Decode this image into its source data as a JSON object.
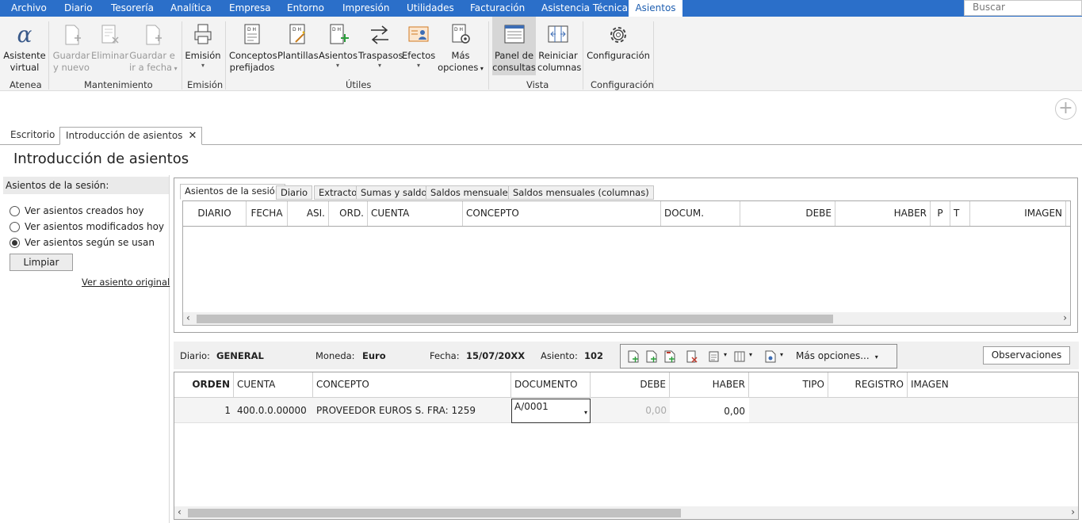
{
  "menu": {
    "items": [
      "Archivo",
      "Diario",
      "Tesorería",
      "Analítica",
      "Empresa",
      "Entorno",
      "Impresión",
      "Utilidades",
      "Facturación",
      "Asistencia Técnica",
      "Asientos"
    ],
    "search_placeholder": "Buscar"
  },
  "ribbon": {
    "buttons": {
      "asistente": [
        "Asistente",
        "virtual"
      ],
      "guardar_nuevo": [
        "Guardar",
        "y nuevo"
      ],
      "eliminar": [
        "Eliminar"
      ],
      "guardar_fecha": [
        "Guardar e",
        "ir a fecha"
      ],
      "emision": [
        "Emisión"
      ],
      "conceptos": [
        "Conceptos",
        "prefijados"
      ],
      "plantillas": [
        "Plantillas"
      ],
      "asientos": [
        "Asientos"
      ],
      "traspasos": [
        "Traspasos"
      ],
      "efectos": [
        "Efectos"
      ],
      "mas_opciones": [
        "Más",
        "opciones"
      ],
      "panel": [
        "Panel de",
        "consultas"
      ],
      "reiniciar": [
        "Reiniciar",
        "columnas"
      ],
      "configuracion": [
        "Configuración"
      ]
    },
    "groups": [
      "Atenea",
      "Mantenimiento",
      "Emisión",
      "Útiles",
      "Vista",
      "Configuración"
    ]
  },
  "page_tabs": [
    "Escritorio",
    "Introducción de asientos"
  ],
  "page_title": "Introducción de asientos",
  "left_panel": {
    "heading": "Asientos de la sesión:",
    "options": [
      "Ver asientos creados hoy",
      "Ver asientos modificados hoy",
      "Ver asientos según se usan"
    ],
    "selected_index": 2,
    "clear_button": "Limpiar",
    "link": "Ver asiento original"
  },
  "upper_tabs": [
    "Asientos de la sesión",
    "Diario",
    "Extracto",
    "Sumas y saldos",
    "Saldos mensuales",
    "Saldos mensuales (columnas)"
  ],
  "upper_columns": [
    "DIARIO",
    "FECHA",
    "ASI.",
    "ORD.",
    "CUENTA",
    "CONCEPTO",
    "DOCUM.",
    "DEBE",
    "HABER",
    "P",
    "T",
    "IMAGEN"
  ],
  "info": {
    "diario_label": "Diario:",
    "diario_value": "GENERAL",
    "moneda_label": "Moneda:",
    "moneda_value": "Euro",
    "fecha_label": "Fecha:",
    "fecha_value": "15/07/20XX",
    "asiento_label": "Asiento:",
    "asiento_value": "102",
    "mas_opciones": "Más opciones...",
    "observaciones": "Observaciones"
  },
  "lower_columns": [
    "ORDEN",
    "CUENTA",
    "CONCEPTO",
    "DOCUMENTO",
    "DEBE",
    "HABER",
    "TIPO",
    "REGISTRO",
    "IMAGEN"
  ],
  "lower_row": {
    "orden": "1",
    "cuenta": "400.0.0.00000",
    "concepto": "PROVEEDOR EUROS S. FRA:  1259",
    "documento": "A/0001",
    "debe": "0,00",
    "haber": "0,00"
  },
  "colors": {
    "accent": "#2b6fc9"
  }
}
